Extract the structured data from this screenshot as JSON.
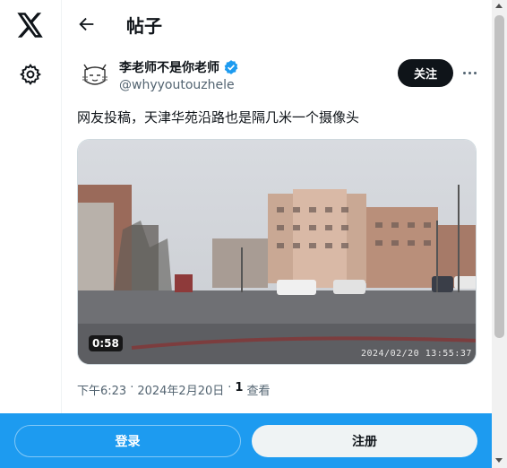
{
  "header": {
    "title": "帖子"
  },
  "post": {
    "author_name": "李老师不是你老师",
    "handle": "@whyyoutouzhele",
    "follow_label": "关注",
    "text": "网友投稿，天津华苑沿路也是隔几米一个摄像头",
    "video_duration": "0:58",
    "video_timestamp": "2024/02/20  13:55:37",
    "time": "下午6:23",
    "separator": "·",
    "date": "2024年2月20日",
    "views_count": "1",
    "views_label": "查看"
  },
  "bottom_bar": {
    "login_label": "登录",
    "signup_label": "注册"
  },
  "icons": [
    "x-logo-icon",
    "settings-gear-icon",
    "back-arrow-icon",
    "verified-badge-icon",
    "more-options-icon"
  ],
  "colors": {
    "accent": "#1d9bf0",
    "text": "#0f1419",
    "muted": "#536471",
    "follow_bg": "#0f1419"
  }
}
